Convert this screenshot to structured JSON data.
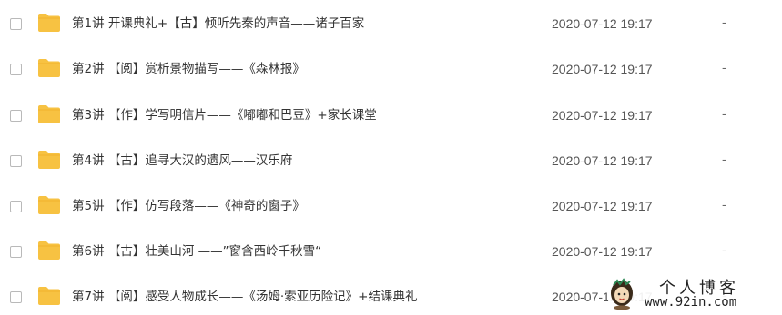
{
  "files": [
    {
      "name": "第1讲 开课典礼+【古】倾听先秦的声音——诸子百家",
      "date": "2020-07-12 19:17",
      "size": "-",
      "icon": "folder-icon"
    },
    {
      "name": "第2讲 【阅】赏析景物描写——《森林报》",
      "date": "2020-07-12 19:17",
      "size": "-",
      "icon": "folder-icon"
    },
    {
      "name": "第3讲 【作】学写明信片——《嘟嘟和巴豆》+家长课堂",
      "date": "2020-07-12 19:17",
      "size": "-",
      "icon": "folder-icon"
    },
    {
      "name": "第4讲 【古】追寻大汉的遗风——汉乐府",
      "date": "2020-07-12 19:17",
      "size": "-",
      "icon": "folder-icon"
    },
    {
      "name": "第5讲 【作】仿写段落——《神奇的窗子》",
      "date": "2020-07-12 19:17",
      "size": "-",
      "icon": "folder-icon"
    },
    {
      "name": "第6讲 【古】壮美山河 ——”窗含西岭千秋雪“",
      "date": "2020-07-12 19:17",
      "size": "-",
      "icon": "folder-icon"
    },
    {
      "name": "第7讲 【阅】感受人物成长——《汤姆·索亚历险记》+结课典礼",
      "date": "2020-07-12 19:17",
      "size": "-",
      "icon": "folder-icon"
    }
  ],
  "watermark": {
    "title": "个人博客",
    "url": "www.92in.com"
  },
  "colors": {
    "folder": "#f7c242",
    "folder_tab": "#f0b22c",
    "checkbox_border": "#b9b9b9"
  }
}
